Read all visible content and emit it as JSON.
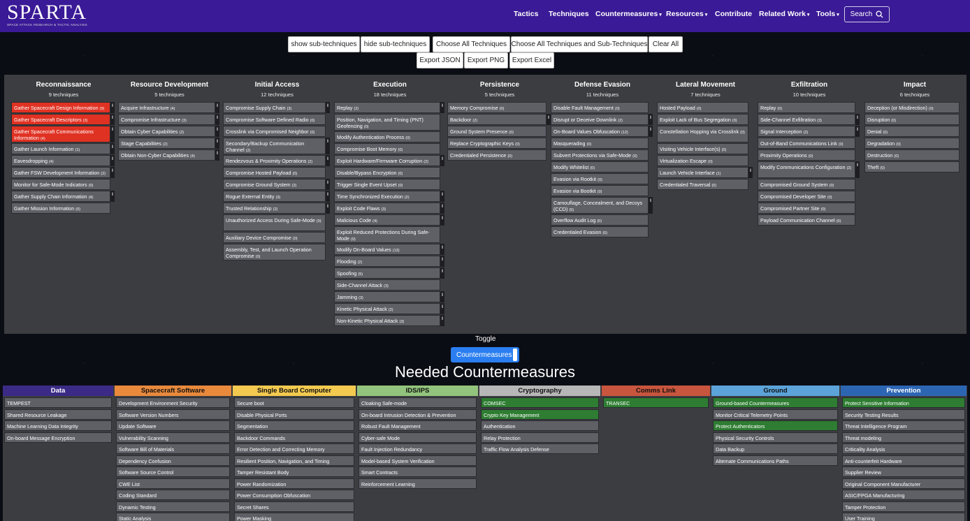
{
  "brand": {
    "title": "SPARTA",
    "subtitle": "SPACE ATTACK RESEARCH & TACTIC ANALYSIS"
  },
  "nav": [
    {
      "label": "Tactics",
      "caret": false
    },
    {
      "label": "Techniques",
      "caret": false
    },
    {
      "label": "Countermeasures",
      "caret": true
    },
    {
      "label": "Resources",
      "caret": true
    },
    {
      "label": "Contribute",
      "caret": false
    },
    {
      "label": "Related Work",
      "caret": true
    },
    {
      "label": "Tools",
      "caret": true
    }
  ],
  "search_label": "Search",
  "buttons": {
    "show_sub": "show sub-techniques",
    "hide_sub": "hide sub-techniques",
    "choose_all": "Choose All Techniques",
    "choose_all_sub": "Choose All Techniques and Sub-Techniques",
    "clear_all": "Clear All",
    "export_json": "Export JSON",
    "export_png": "Export PNG",
    "export_excel": "Export Excel"
  },
  "tactics": [
    {
      "name": "Reconnaissance",
      "count": "9 techniques",
      "techniques": [
        {
          "label": "Gather Spacecraft Design Information",
          "n": "(9)",
          "red": true,
          "sub": true
        },
        {
          "label": "Gather Spacecraft Descriptors",
          "n": "(3)",
          "red": true,
          "sub": true
        },
        {
          "label": "Gather Spacecraft Communications Information",
          "n": "(4)",
          "red": true,
          "sub": true,
          "tall": true
        },
        {
          "label": "Gather Launch Information",
          "n": "(1)",
          "sub": true
        },
        {
          "label": "Eavesdropping",
          "n": "(4)",
          "sub": true
        },
        {
          "label": "Gather FSW Development Information",
          "n": "(2)",
          "sub": true
        },
        {
          "label": "Monitor for Safe-Mode Indicators",
          "n": "(0)"
        },
        {
          "label": "Gather Supply Chain Information",
          "n": "(4)",
          "sub": true
        },
        {
          "label": "Gather Mission Information",
          "n": "(0)"
        }
      ]
    },
    {
      "name": "Resource Development",
      "count": "5 techniques",
      "techniques": [
        {
          "label": "Acquire Infrastructure",
          "n": "(4)",
          "sub": true
        },
        {
          "label": "Compromise Infrastructure",
          "n": "(3)",
          "sub": true
        },
        {
          "label": "Obtain Cyber Capabilities",
          "n": "(2)",
          "sub": true
        },
        {
          "label": "Stage Capabilities",
          "n": "(2)",
          "sub": true
        },
        {
          "label": "Obtain Non-Cyber Capabilities",
          "n": "(4)",
          "sub": true
        }
      ]
    },
    {
      "name": "Initial Access",
      "count": "12 techniques",
      "techniques": [
        {
          "label": "Compromise Supply Chain",
          "n": "(3)",
          "sub": true
        },
        {
          "label": "Compromise Software Defined Radio",
          "n": "(0)"
        },
        {
          "label": "Crosslink via Compromised Neighbor",
          "n": "(0)"
        },
        {
          "label": "Secondary/Backup Communication Channel",
          "n": "(2)",
          "sub": true,
          "tall": true
        },
        {
          "label": "Rendezvous & Proximity Operations",
          "n": "(2)",
          "sub": true
        },
        {
          "label": "Compromise Hosted Payload",
          "n": "(0)"
        },
        {
          "label": "Compromise Ground System",
          "n": "(2)",
          "sub": true
        },
        {
          "label": "Rogue External Entity",
          "n": "(3)",
          "sub": true
        },
        {
          "label": "Trusted Relationship",
          "n": "(2)",
          "sub": true
        },
        {
          "label": "Unauthorized Access During Safe-Mode",
          "n": "(0)",
          "tall": true
        },
        {
          "label": "Auxiliary Device Compromise",
          "n": "(0)"
        },
        {
          "label": "Assembly, Test, and Launch Operation Compromise",
          "n": "(0)",
          "tall": true
        }
      ]
    },
    {
      "name": "Execution",
      "count": "18 techniques",
      "techniques": [
        {
          "label": "Replay",
          "n": "(2)",
          "sub": true
        },
        {
          "label": "Position, Navigation, and Timing (PNT) Geofencing",
          "n": "(0)",
          "tall": true
        },
        {
          "label": "Modify Authentication Process",
          "n": "(0)"
        },
        {
          "label": "Compromise Boot Memory",
          "n": "(0)"
        },
        {
          "label": "Exploit Hardware/Firmware Corruption",
          "n": "(2)",
          "sub": true
        },
        {
          "label": "Disable/Bypass Encryption",
          "n": "(0)"
        },
        {
          "label": "Trigger Single Event Upset",
          "n": "(0)"
        },
        {
          "label": "Time Synchronized Execution",
          "n": "(2)",
          "sub": true
        },
        {
          "label": "Exploit Code Flaws",
          "n": "(3)",
          "sub": true
        },
        {
          "label": "Malicious Code",
          "n": "(4)",
          "sub": true
        },
        {
          "label": "Exploit Reduced Protections During Safe-Mode",
          "n": "(0)",
          "tall": true
        },
        {
          "label": "Modify On-Board Values",
          "n": "(13)",
          "sub": true
        },
        {
          "label": "Flooding",
          "n": "(2)",
          "sub": true
        },
        {
          "label": "Spoofing",
          "n": "(5)",
          "sub": true
        },
        {
          "label": "Side-Channel Attack",
          "n": "(3)"
        },
        {
          "label": "Jamming",
          "n": "(3)",
          "sub": true
        },
        {
          "label": "Kinetic Physical Attack",
          "n": "(2)",
          "sub": true
        },
        {
          "label": "Non-Kinetic Physical Attack",
          "n": "(3)",
          "sub": true
        }
      ]
    },
    {
      "name": "Persistence",
      "count": "5 techniques",
      "techniques": [
        {
          "label": "Memory Compromise",
          "n": "(0)"
        },
        {
          "label": "Backdoor",
          "n": "(2)",
          "sub": true
        },
        {
          "label": "Ground System Presence",
          "n": "(0)"
        },
        {
          "label": "Replace Cryptographic Keys",
          "n": "(0)"
        },
        {
          "label": "Credentialed Persistence",
          "n": "(0)"
        }
      ]
    },
    {
      "name": "Defense Evasion",
      "count": "11 techniques",
      "techniques": [
        {
          "label": "Disable Fault Management",
          "n": "(0)"
        },
        {
          "label": "Disrupt or Deceive Downlink",
          "n": "(2)",
          "sub": true
        },
        {
          "label": "On-Board Values Obfuscation",
          "n": "(12)",
          "sub": true
        },
        {
          "label": "Masquerading",
          "n": "(0)"
        },
        {
          "label": "Subvert Protections via Safe-Mode",
          "n": "(0)"
        },
        {
          "label": "Modify Whitelist",
          "n": "(0)"
        },
        {
          "label": "Evasion via Rootkit",
          "n": "(0)"
        },
        {
          "label": "Evasion via Bootkit",
          "n": "(0)"
        },
        {
          "label": "Camouflage, Concealment, and Decoys (CCD)",
          "n": "(5)",
          "sub": true,
          "tall": true
        },
        {
          "label": "Overflow Audit Log",
          "n": "(0)"
        },
        {
          "label": "Credentialed Evasion",
          "n": "(0)"
        }
      ]
    },
    {
      "name": "Lateral Movement",
      "count": "7 techniques",
      "techniques": [
        {
          "label": "Hosted Payload",
          "n": "(0)"
        },
        {
          "label": "Exploit Lack of Bus Segregation",
          "n": "(0)"
        },
        {
          "label": "Constellation Hopping via Crosslink",
          "n": "(0)",
          "tall": true
        },
        {
          "label": "Visiting Vehicle Interface(s)",
          "n": "(0)"
        },
        {
          "label": "Virtualization Escape",
          "n": "(0)"
        },
        {
          "label": "Launch Vehicle Interface",
          "n": "(1)",
          "sub": true
        },
        {
          "label": "Credentialed Traversal",
          "n": "(0)"
        }
      ]
    },
    {
      "name": "Exfiltration",
      "count": "10 techniques",
      "techniques": [
        {
          "label": "Replay",
          "n": "(0)"
        },
        {
          "label": "Side-Channel Exfiltration",
          "n": "(3)",
          "sub": true
        },
        {
          "label": "Signal Interception",
          "n": "(2)",
          "sub": true
        },
        {
          "label": "Out-of-Band Communications Link",
          "n": "(0)"
        },
        {
          "label": "Proximity Operations",
          "n": "(0)"
        },
        {
          "label": "Modify Communications Configuration",
          "n": "(2)",
          "sub": true,
          "tall": true
        },
        {
          "label": "Compromised Ground System",
          "n": "(0)"
        },
        {
          "label": "Compromised Developer Site",
          "n": "(0)"
        },
        {
          "label": "Compromised Partner Site",
          "n": "(0)"
        },
        {
          "label": "Payload Communication Channel",
          "n": "(0)"
        }
      ]
    },
    {
      "name": "Impact",
      "count": "6 techniques",
      "techniques": [
        {
          "label": "Deception (or Misdirection)",
          "n": "(0)"
        },
        {
          "label": "Disruption",
          "n": "(0)"
        },
        {
          "label": "Denial",
          "n": "(0)"
        },
        {
          "label": "Degradation",
          "n": "(0)"
        },
        {
          "label": "Destruction",
          "n": "(0)"
        },
        {
          "label": "Theft",
          "n": "(0)"
        }
      ]
    }
  ],
  "toggle": {
    "label": "Toggle",
    "button": "Countermeasures"
  },
  "needed_title": "Needed Countermeasures",
  "cm_categories": [
    {
      "name": "Data",
      "color": "#3b2b86",
      "text": "#ffffff",
      "items": [
        {
          "label": "TEMPEST"
        },
        {
          "label": "Shared Resource Leakage"
        },
        {
          "label": "Machine Learning Data Integrity"
        },
        {
          "label": "On-board Message Encryption"
        }
      ]
    },
    {
      "name": "Spacecraft Software",
      "color": "#e8893c",
      "text": "#111111",
      "items": [
        {
          "label": "Development Environment Security"
        },
        {
          "label": "Software Version Numbers"
        },
        {
          "label": "Update Software"
        },
        {
          "label": "Vulnerability Scanning"
        },
        {
          "label": "Software Bill of Materials"
        },
        {
          "label": "Dependency Confusion"
        },
        {
          "label": "Software Source Control"
        },
        {
          "label": "CWE List"
        },
        {
          "label": "Coding Standard"
        },
        {
          "label": "Dynamic Testing"
        },
        {
          "label": "Static Analysis"
        }
      ]
    },
    {
      "name": "Single Board Computer",
      "color": "#f3c94f",
      "text": "#111111",
      "items": [
        {
          "label": "Secure boot"
        },
        {
          "label": "Disable Physical Ports"
        },
        {
          "label": "Segmentation"
        },
        {
          "label": "Backdoor Commands"
        },
        {
          "label": "Error Detection and Correcting Memory"
        },
        {
          "label": "Resilient Position, Navigation, and Timing"
        },
        {
          "label": "Tamper Resistant Body"
        },
        {
          "label": "Power Randomization"
        },
        {
          "label": "Power Consumption Obfuscation"
        },
        {
          "label": "Secret Shares"
        },
        {
          "label": "Power Masking"
        }
      ]
    },
    {
      "name": "IDS/IPS",
      "color": "#93c47d",
      "text": "#111111",
      "items": [
        {
          "label": "Cloaking Safe-mode"
        },
        {
          "label": "On-board Intrusion Detection & Prevention"
        },
        {
          "label": "Robust Fault Management"
        },
        {
          "label": "Cyber-safe Mode"
        },
        {
          "label": "Fault Injection Redundancy"
        },
        {
          "label": "Model-based System Verification"
        },
        {
          "label": "Smart Contracts"
        },
        {
          "label": "Reinforcement Learning"
        }
      ]
    },
    {
      "name": "Cryptography",
      "color": "#b7b7b7",
      "text": "#111111",
      "items": [
        {
          "label": "COMSEC",
          "green": true
        },
        {
          "label": "Crypto Key Management",
          "green": true
        },
        {
          "label": "Authentication"
        },
        {
          "label": "Relay Protection"
        },
        {
          "label": "Traffic Flow Analysis Defense"
        }
      ]
    },
    {
      "name": "Comms Link",
      "color": "#c8553d",
      "text": "#111111",
      "items": [
        {
          "label": "TRANSEC",
          "green": true
        }
      ]
    },
    {
      "name": "Ground",
      "color": "#5ba3d9",
      "text": "#111111",
      "items": [
        {
          "label": "Ground-based Countermeasures",
          "green": true
        },
        {
          "label": "Monitor Critical Telemetry Points"
        },
        {
          "label": "Protect Authenticators",
          "green": true
        },
        {
          "label": "Physical Security Controls"
        },
        {
          "label": "Data Backup"
        },
        {
          "label": "Alternate Communications Paths"
        }
      ]
    },
    {
      "name": "Prevention",
      "color": "#2c66b3",
      "text": "#ffffff",
      "items": [
        {
          "label": "Protect Sensitive Information",
          "green": true
        },
        {
          "label": "Security Testing Results"
        },
        {
          "label": "Threat Intelligence Program"
        },
        {
          "label": "Threat modeling"
        },
        {
          "label": "Criticality Analysis"
        },
        {
          "label": "Anti-counterfeit Hardware"
        },
        {
          "label": "Supplier Review"
        },
        {
          "label": "Original Component Manufacturer"
        },
        {
          "label": "ASIC/FPGA Manufacturing"
        },
        {
          "label": "Tamper Protection"
        },
        {
          "label": "User Training"
        }
      ]
    }
  ]
}
